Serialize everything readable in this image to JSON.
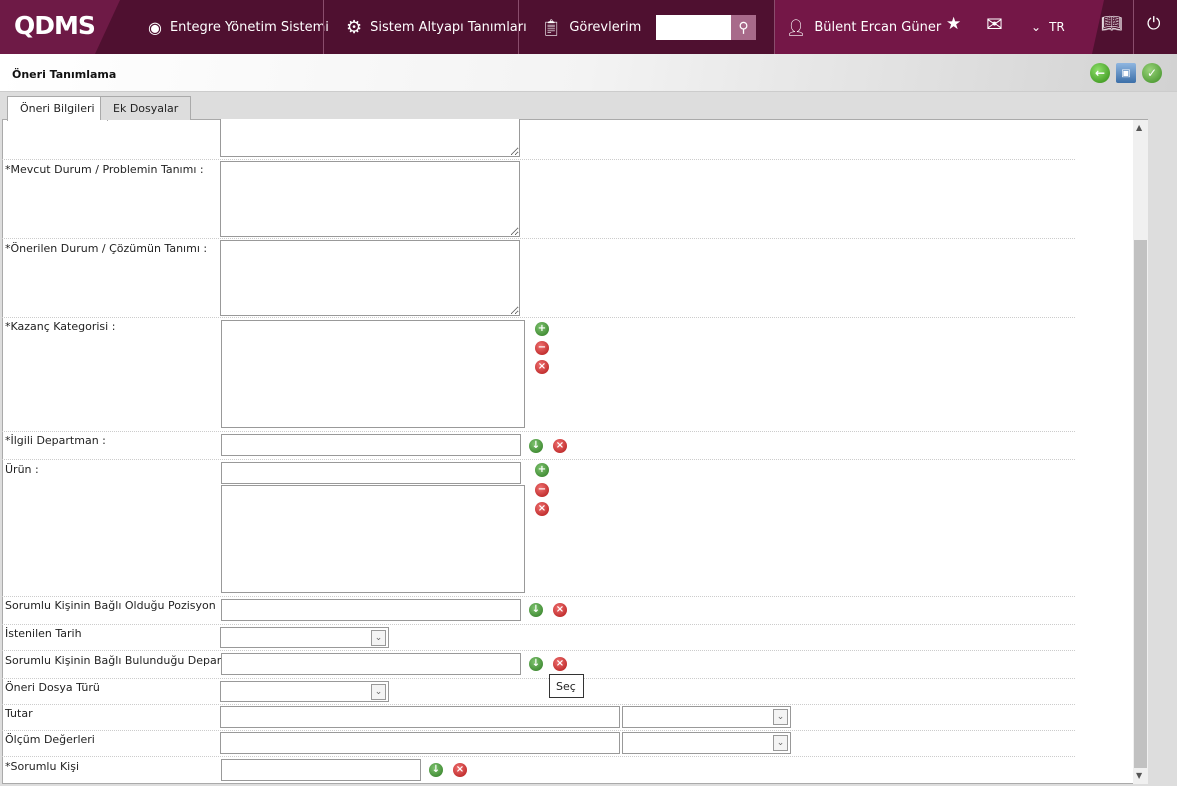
{
  "header": {
    "logo": "QDMS",
    "nav": [
      "Entegre Yönetim Sistemi",
      "Sistem Altyapı Tanımları",
      "Görevlerim"
    ],
    "search_placeholder": "",
    "user": "Bülent Ercan Güner",
    "lang": "TR"
  },
  "page": {
    "title": "Öneri Tanımlama",
    "tabs": [
      "Öneri Bilgileri",
      "Ek Dosyalar"
    ]
  },
  "form": {
    "mevcut": "*Mevcut Durum / Problemin Tanımı :",
    "onerilen": "*Önerilen Durum / Çözümün Tanımı :",
    "kazanc": "*Kazanç Kategorisi :",
    "ilgili": "*İlgili Departman :",
    "urun": "Ürün :",
    "pozisyon": "Sorumlu Kişinin Bağlı Olduğu Pozisyon",
    "tarih": "İstenilen Tarih",
    "departman": "Sorumlu Kişinin Bağlı Bulunduğu Departman",
    "dosya": "Öneri Dosya Türü",
    "tutar": "Tutar",
    "olcum": "Ölçüm Değerleri",
    "sorumlu": "*Sorumlu Kişi"
  },
  "tooltip": "Seç"
}
